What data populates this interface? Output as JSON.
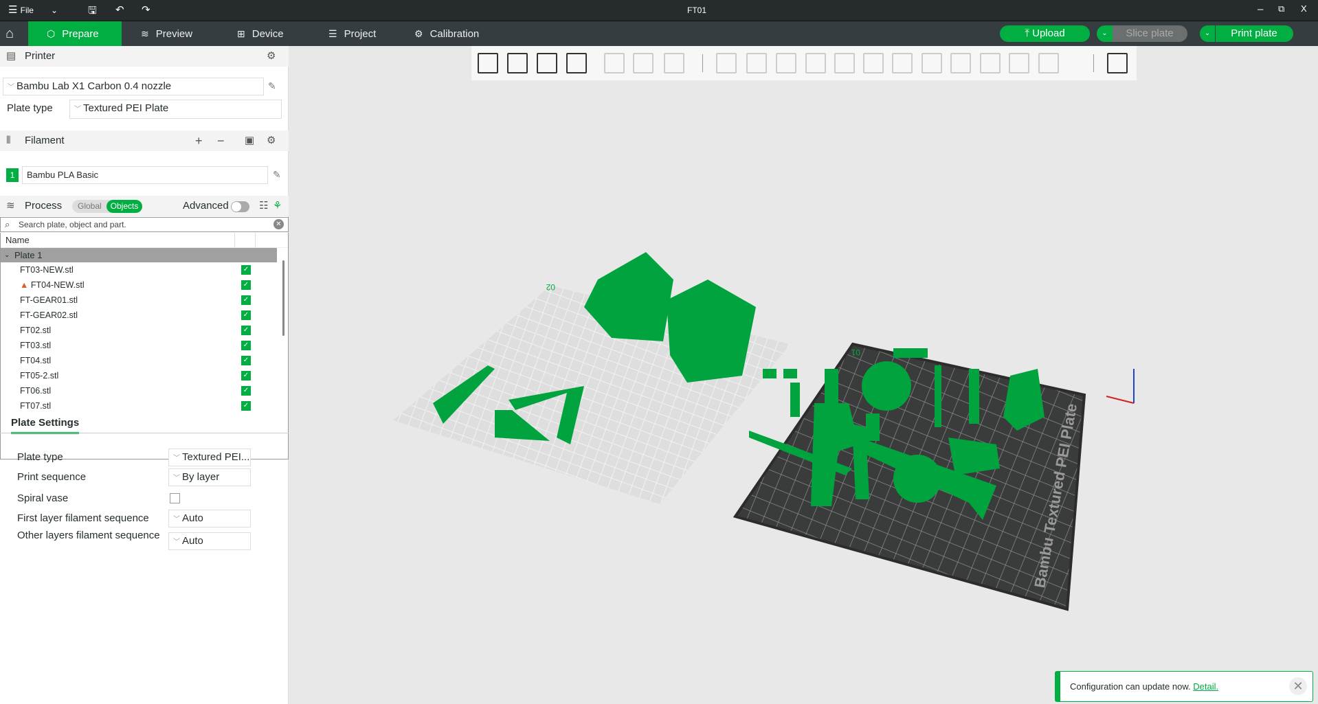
{
  "window": {
    "title": "FT01",
    "file_label": "File"
  },
  "tabs": [
    {
      "label": "Prepare",
      "icon": "cube-icon"
    },
    {
      "label": "Preview",
      "icon": "layers-icon"
    },
    {
      "label": "Device",
      "icon": "device-icon"
    },
    {
      "label": "Project",
      "icon": "project-icon"
    },
    {
      "label": "Calibration",
      "icon": "calibration-icon"
    }
  ],
  "actions": {
    "upload": "Upload",
    "slice": "Slice plate",
    "print": "Print plate"
  },
  "printer": {
    "header": "Printer",
    "name": "Bambu Lab X1 Carbon 0.4 nozzle",
    "plate_type_label": "Plate type",
    "plate_type": "Textured PEI Plate"
  },
  "filament": {
    "header": "Filament",
    "slot": "1",
    "name": "Bambu PLA Basic",
    "color": "#00ae42"
  },
  "process": {
    "header": "Process",
    "global": "Global",
    "objects": "Objects",
    "advanced": "Advanced",
    "advanced_on": false
  },
  "search": {
    "placeholder": "Search plate, object and part."
  },
  "tree": {
    "col_name": "Name",
    "plate": "Plate 1",
    "items": [
      {
        "name": "FT03-NEW.stl",
        "warning": false
      },
      {
        "name": "FT04-NEW.stl",
        "warning": true
      },
      {
        "name": "FT-GEAR01.stl",
        "warning": false
      },
      {
        "name": "FT-GEAR02.stl",
        "warning": false
      },
      {
        "name": "FT02.stl",
        "warning": false
      },
      {
        "name": "FT03.stl",
        "warning": false
      },
      {
        "name": "FT04.stl",
        "warning": false
      },
      {
        "name": "FT05-2.stl",
        "warning": false
      },
      {
        "name": "FT06.stl",
        "warning": false
      },
      {
        "name": "FT07.stl",
        "warning": false
      }
    ]
  },
  "plate_settings": {
    "tab": "Plate Settings",
    "rows": [
      {
        "label": "Plate type",
        "value": "Textured PEI..."
      },
      {
        "label": "Print sequence",
        "value": "By layer"
      },
      {
        "label": "Spiral vase",
        "checked": false
      },
      {
        "label": "First layer filament sequence",
        "value": "Auto"
      },
      {
        "label": "Other layers filament sequence",
        "value": "Auto"
      }
    ]
  },
  "viewport": {
    "plate_labels": [
      "02",
      "01"
    ],
    "bed_text": "Bambu Textured PEI Plate",
    "model_color": "#00ae42"
  },
  "notification": {
    "text": "Configuration can update now.",
    "link": "Detail."
  }
}
